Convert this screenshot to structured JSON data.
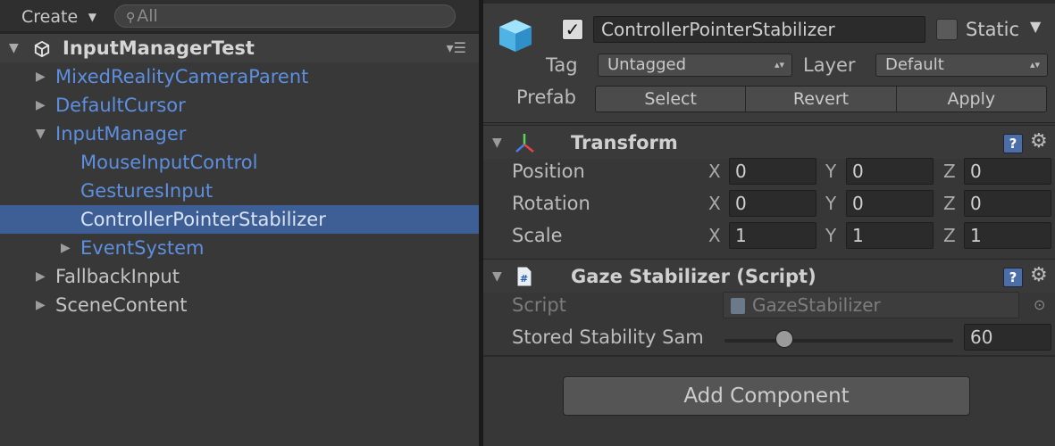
{
  "hierarchy": {
    "create_label": "Create",
    "search_placeholder": "All",
    "scene_name": "InputManagerTest",
    "items": [
      {
        "label": "MixedRealityCameraParent",
        "expanded": false,
        "prefab": true
      },
      {
        "label": "DefaultCursor",
        "expanded": false,
        "prefab": true
      },
      {
        "label": "InputManager",
        "expanded": true,
        "prefab": true
      },
      {
        "label": "MouseInputControl",
        "prefab": true
      },
      {
        "label": "GesturesInput",
        "prefab": true
      },
      {
        "label": "ControllerPointerStabilizer",
        "prefab": true,
        "selected": true
      },
      {
        "label": "EventSystem",
        "expanded": false,
        "prefab": true
      },
      {
        "label": "FallbackInput",
        "expanded": false,
        "prefab": false
      },
      {
        "label": "SceneContent",
        "expanded": false,
        "prefab": false
      }
    ]
  },
  "inspector": {
    "object_name": "ControllerPointerStabilizer",
    "active_checked": true,
    "static_label": "Static",
    "static_checked": false,
    "tag_label": "Tag",
    "tag_value": "Untagged",
    "layer_label": "Layer",
    "layer_value": "Default",
    "prefab_label": "Prefab",
    "prefab_buttons": [
      "Select",
      "Revert",
      "Apply"
    ],
    "transform": {
      "title": "Transform",
      "rows": [
        {
          "label": "Position",
          "x": "0",
          "y": "0",
          "z": "0"
        },
        {
          "label": "Rotation",
          "x": "0",
          "y": "0",
          "z": "0"
        },
        {
          "label": "Scale",
          "x": "1",
          "y": "1",
          "z": "1"
        }
      ],
      "axes": [
        "X",
        "Y",
        "Z"
      ]
    },
    "gaze": {
      "title": "Gaze Stabilizer (Script)",
      "script_label": "Script",
      "script_value": "GazeStabilizer",
      "samples_label": "Stored Stability Sam",
      "samples_value": "60"
    },
    "add_component_label": "Add Component"
  },
  "colors": {
    "selection": "#3e5f96",
    "prefab_text": "#5d8fe0",
    "panel_bg": "#383838"
  }
}
